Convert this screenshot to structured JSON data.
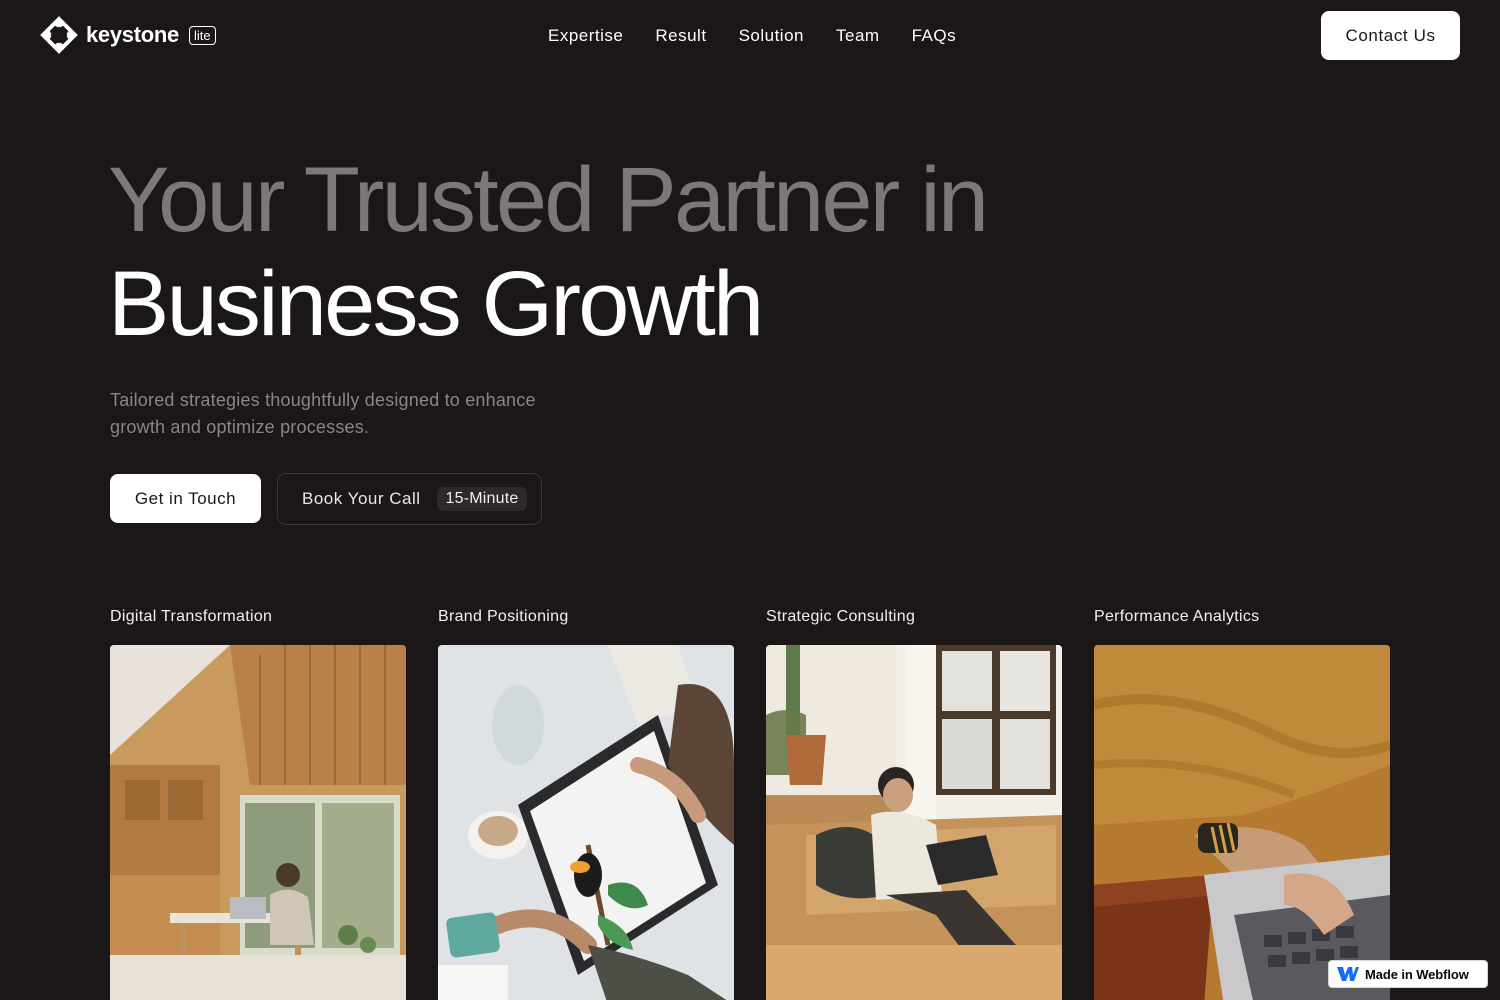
{
  "brand": {
    "name": "keystone",
    "badge": "lite"
  },
  "nav": {
    "links": [
      "Expertise",
      "Result",
      "Solution",
      "Team",
      "FAQs"
    ],
    "contact_label": "Contact Us"
  },
  "hero": {
    "title_line1": "Your Trusted Partner in",
    "title_line2": "Business Growth",
    "subtitle": "Tailored strategies thoughtfully designed to enhance growth and optimize processes.",
    "primary_cta": "Get in Touch",
    "secondary_cta": "Book Your Call",
    "secondary_chip": "15-Minute"
  },
  "cards": [
    {
      "title": "Digital Transformation",
      "image": "person-at-laptop-in-wooden-cabin-photo"
    },
    {
      "title": "Brand Positioning",
      "image": "hands-drawing-toucan-on-tablet-photo"
    },
    {
      "title": "Strategic Consulting",
      "image": "man-with-laptop-on-leather-sofa-photo"
    },
    {
      "title": "Performance Analytics",
      "image": "hands-typing-on-laptop-photo"
    }
  ],
  "webflow_badge": {
    "label": "Made in Webflow"
  },
  "colors": {
    "background": "#1b1718",
    "muted_heading": "#7b7878",
    "muted_text": "#8a8686",
    "button_bg": "#ffffff"
  }
}
